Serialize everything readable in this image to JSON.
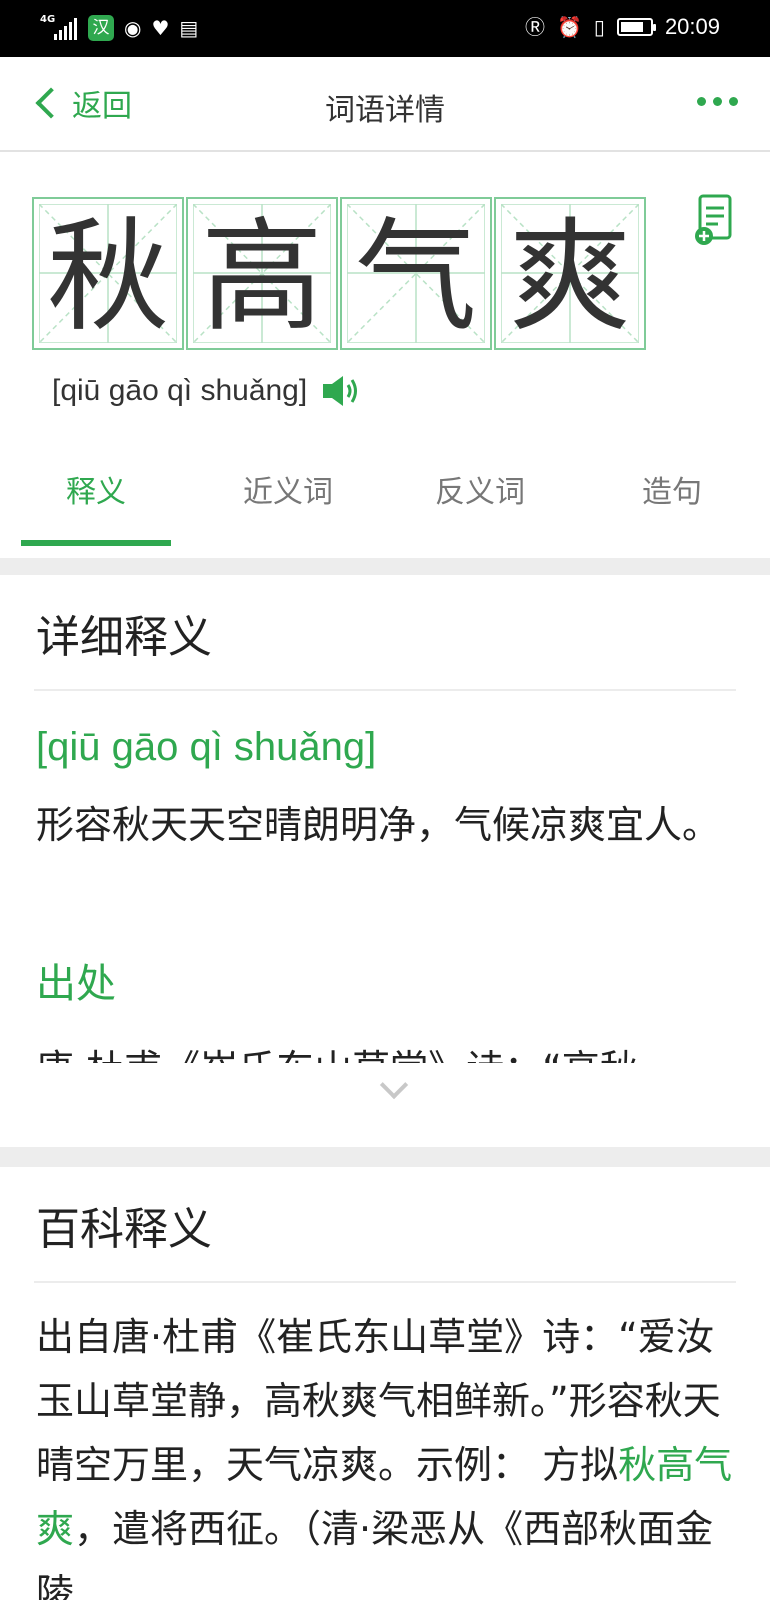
{
  "status_bar": {
    "network": "4G",
    "app_badge": "汉",
    "time": "20:09",
    "battery_percent": 80
  },
  "header": {
    "back_label": "返回",
    "title": "词语详情"
  },
  "word": {
    "characters": [
      "秋",
      "高",
      "气",
      "爽"
    ],
    "pinyin": "[qiū gāo qì shuǎng]"
  },
  "tabs": [
    {
      "label": "释义",
      "active": true
    },
    {
      "label": "近义词",
      "active": false
    },
    {
      "label": "反义词",
      "active": false
    },
    {
      "label": "造句",
      "active": false
    }
  ],
  "detail": {
    "title": "详细释义",
    "pinyin": "[qiū gāo qì shuǎng]",
    "definition": "形容秋天天空晴朗明净，气候凉爽宜人。",
    "source_title": "出处",
    "source_text_partial": "唐·杜甫《崔氏东山草堂》诗：“高秋"
  },
  "baike": {
    "title": "百科释义",
    "text_before": "出自唐·杜甫《崔氏东山草堂》诗：“爱汝玉山草堂静，高秋爽气相鲜新。”形容秋天晴空万里，天气凉爽。示例： 方拟",
    "highlight": "秋高气爽",
    "text_after": "，遣将西征。（清·梁恶从《西部秋面金陵"
  },
  "colors": {
    "accent": "#2fa84f",
    "grid_line": "#7fcb98"
  }
}
